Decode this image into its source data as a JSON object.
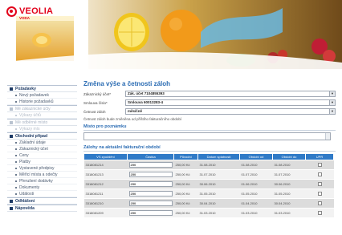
{
  "brand": {
    "name": "VEOLIA",
    "sub": "VODA",
    "color": "#e2001a"
  },
  "sidebar": {
    "sections": [
      {
        "label": "Požadavky",
        "dim": false,
        "items": [
          {
            "label": "Nový požadavek",
            "dim": false
          },
          {
            "label": "Historie požadavků",
            "dim": false
          }
        ]
      },
      {
        "label": "Mé zákaznické účty",
        "dim": true,
        "items": [
          {
            "label": "Výkazy účtů",
            "dim": true
          }
        ]
      },
      {
        "label": "Mé odběrné místo",
        "dim": true,
        "items": [
          {
            "label": "Výkazy mís",
            "dim": true
          }
        ]
      },
      {
        "label": "Obchodní případ",
        "dim": false,
        "items": [
          {
            "label": "Základní údaje",
            "dim": false
          },
          {
            "label": "Zákaznický účet",
            "dim": false
          },
          {
            "label": "Ceny",
            "dim": false
          },
          {
            "label": "Platby",
            "dim": false
          },
          {
            "label": "Vystavené předpisy",
            "dim": false
          },
          {
            "label": "Měřicí místa a odečty",
            "dim": false
          },
          {
            "label": "Přerušení dodávky",
            "dim": false
          },
          {
            "label": "Dokumenty",
            "dim": false
          },
          {
            "label": "Události",
            "dim": false
          }
        ]
      },
      {
        "label": "Odhlášení",
        "dim": false,
        "items": []
      },
      {
        "label": "Nápověda",
        "dim": false,
        "items": []
      }
    ]
  },
  "main": {
    "title": "Změna výše a četnosti záloh",
    "fields": [
      {
        "label": "Zákaznický účet*",
        "value": "Zák. účet 7104855393"
      },
      {
        "label": "Smlouva číslo*",
        "value": "Smlouva 60013283-4"
      },
      {
        "label": "Četnost záloh",
        "value": "měsíčně"
      }
    ],
    "note": "Četnost záloh bude změněna od příštího fakturačního období",
    "notes_title": "Místo pro poznámku",
    "table_title": "Zálohy na aktuální fakturační období",
    "table": {
      "headers": [
        "VS zpoždění",
        "Částka",
        "Původní",
        "Datum splatnosti",
        "Období od",
        "Období do",
        "UPR"
      ],
      "rows": [
        [
          "3318081214",
          "250",
          "250,00 Kč",
          "31.08.2010",
          "01.08.2010",
          "31.08.2010"
        ],
        [
          "3318081213",
          "250",
          "250,00 Kč",
          "31.07.2010",
          "01.07.2010",
          "31.07.2010"
        ],
        [
          "3318081212",
          "250",
          "250,00 Kč",
          "30.06.2010",
          "01.06.2010",
          "30.06.2010"
        ],
        [
          "3318081211",
          "250",
          "250,00 Kč",
          "31.05.2010",
          "01.05.2010",
          "31.05.2010"
        ],
        [
          "3318081210",
          "250",
          "250,00 Kč",
          "30.04.2010",
          "01.04.2010",
          "30.04.2010"
        ],
        [
          "3318081209",
          "250",
          "250,00 Kč",
          "31.03.2010",
          "01.03.2010",
          "31.03.2010"
        ]
      ]
    }
  },
  "colors": {
    "accent": "#2b6cb3",
    "table_header": "#2f7ac7",
    "sidebar_text": "#1e3b66"
  }
}
